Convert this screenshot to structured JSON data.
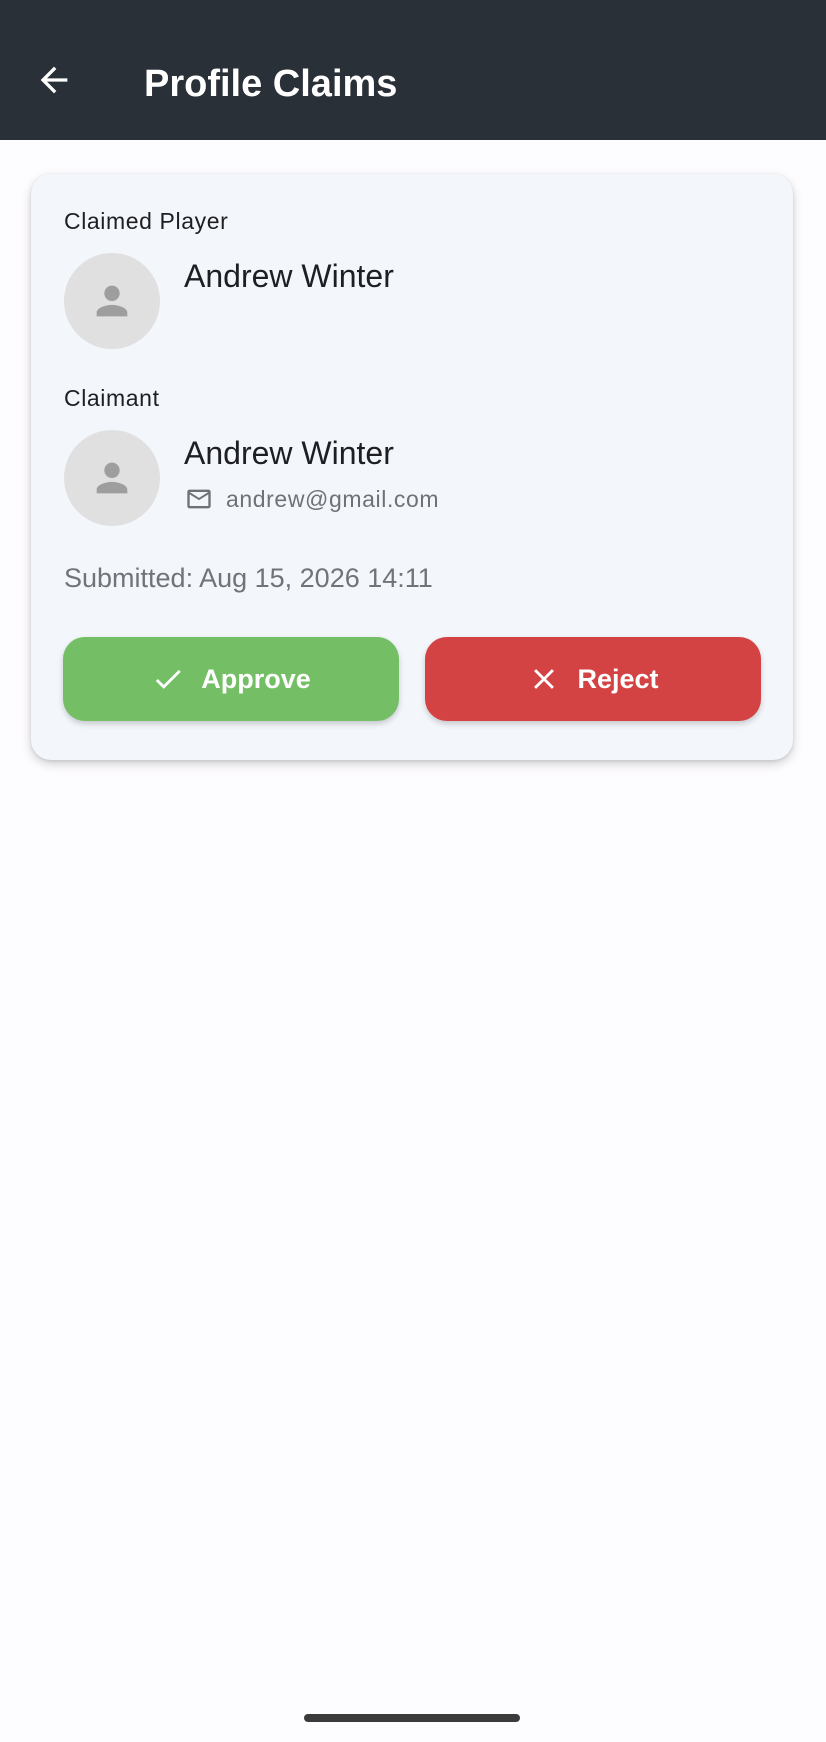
{
  "app_bar": {
    "title": "Profile Claims",
    "back_icon": "arrow-left-icon"
  },
  "claim": {
    "claimed_player": {
      "label": "Claimed Player",
      "name": "Andrew Winter",
      "avatar_icon": "person-icon"
    },
    "claimant": {
      "label": "Claimant",
      "name": "Andrew Winter",
      "email_icon": "mail-icon",
      "email": "andrew@gmail.com",
      "avatar_icon": "person-icon"
    },
    "submitted": "Submitted: Aug 15, 2026 14:11",
    "actions": {
      "approve_label": "Approve",
      "approve_icon": "check-icon",
      "reject_label": "Reject",
      "reject_icon": "close-icon"
    }
  },
  "colors": {
    "app_bar_bg": "#2a3037",
    "card_bg": "#f3f6fa",
    "approve": "#74bf65",
    "reject": "#d44343",
    "avatar_bg": "#e0e0e0"
  }
}
